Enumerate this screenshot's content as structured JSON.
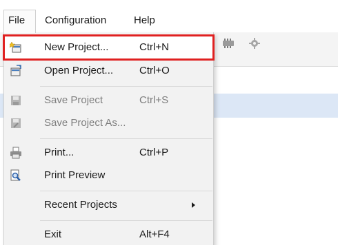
{
  "menubar": {
    "file": "File",
    "configuration": "Configuration",
    "help": "Help"
  },
  "toolbar": {
    "icons": [
      "chip-icon",
      "gear-icon"
    ]
  },
  "file_menu": {
    "items": [
      {
        "label": "New Project...",
        "shortcut": "Ctrl+N",
        "icon": "new-project-icon",
        "enabled": true,
        "highlighted": true
      },
      {
        "label": "Open Project...",
        "shortcut": "Ctrl+O",
        "icon": "open-project-icon",
        "enabled": true
      },
      {
        "label": "Save Project",
        "shortcut": "Ctrl+S",
        "icon": "save-icon",
        "enabled": false
      },
      {
        "label": "Save Project As...",
        "shortcut": "",
        "icon": "save-as-icon",
        "enabled": false
      },
      {
        "label": "Print...",
        "shortcut": "Ctrl+P",
        "icon": "printer-icon",
        "enabled": true
      },
      {
        "label": "Print Preview",
        "shortcut": "",
        "icon": "print-preview-icon",
        "enabled": true
      },
      {
        "label": "Recent Projects",
        "shortcut": "",
        "icon": "",
        "enabled": true,
        "submenu": true
      },
      {
        "label": "Exit",
        "shortcut": "Alt+F4",
        "icon": "",
        "enabled": true
      }
    ]
  },
  "colors": {
    "highlight_border": "#e02020",
    "menu_background": "#f2f2f2",
    "content_header": "#dce7f6"
  }
}
